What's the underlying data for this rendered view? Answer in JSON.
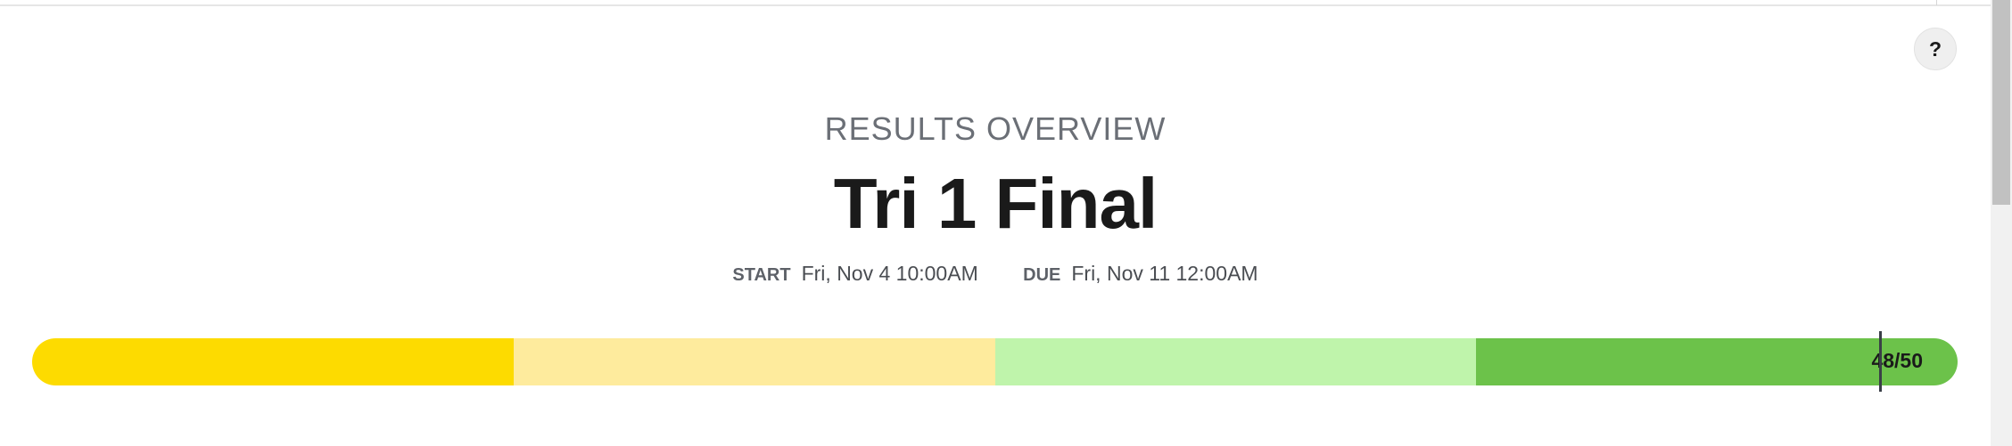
{
  "help": {
    "label": "?"
  },
  "header": {
    "subtitle": "RESULTS OVERVIEW",
    "title": "Tri 1 Final"
  },
  "dates": {
    "start_label": "START",
    "start_value": "Fri, Nov 4 10:00AM",
    "due_label": "DUE",
    "due_value": "Fri, Nov 11 12:00AM"
  },
  "score": {
    "text": "48/50",
    "earned": 48,
    "total": 50
  },
  "progress_segments": [
    {
      "color": "#fddb00",
      "fraction": 0.25
    },
    {
      "color": "#feeb9d",
      "fraction": 0.25
    },
    {
      "color": "#bff4ab",
      "fraction": 0.25
    },
    {
      "color": "#6cc24a",
      "fraction": 0.25
    }
  ],
  "colors": {
    "marker": "#3a3f47"
  }
}
